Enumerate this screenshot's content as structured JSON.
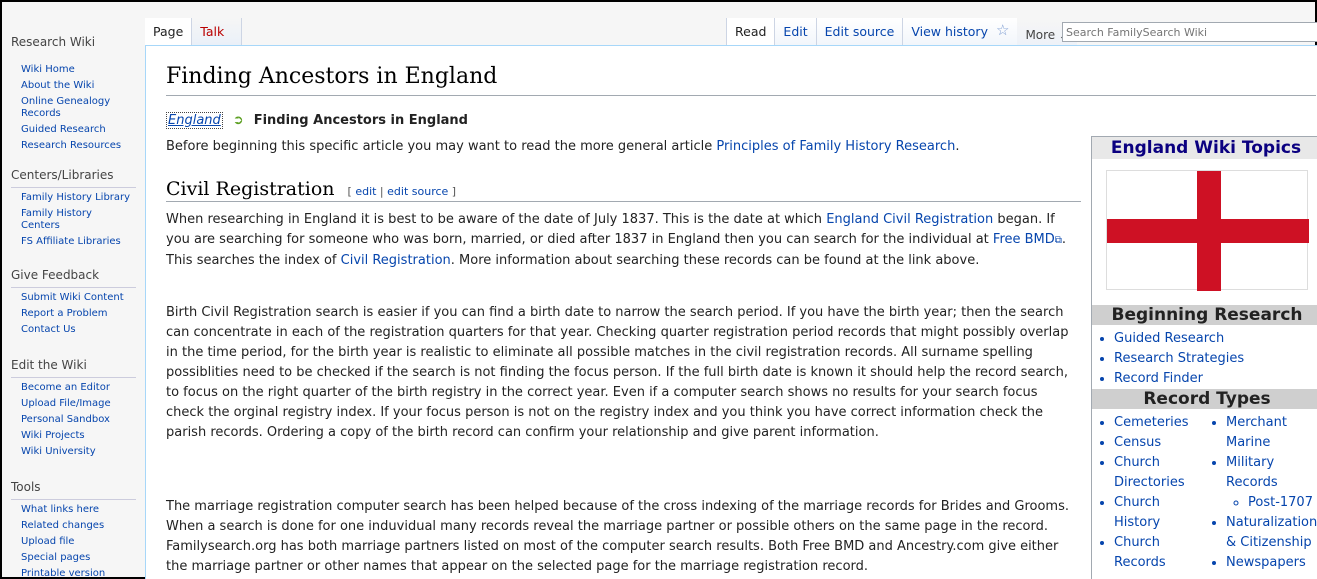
{
  "sidebar": {
    "site_name": "Research Wiki",
    "portals": [
      {
        "heading": "",
        "items": [
          "Wiki Home",
          "About the Wiki",
          "Online Genealogy Records",
          "Guided Research",
          "Research Resources"
        ]
      },
      {
        "heading": "Centers/Libraries",
        "items": [
          "Family History Library",
          "Family History Centers",
          "FS Affiliate Libraries"
        ]
      },
      {
        "heading": "Give Feedback",
        "items": [
          "Submit Wiki Content",
          "Report a Problem",
          "Contact Us"
        ]
      },
      {
        "heading": "Edit the Wiki",
        "items": [
          "Become an Editor",
          "Upload File/Image",
          "Personal Sandbox",
          "Wiki Projects",
          "Wiki University"
        ]
      },
      {
        "heading": "Tools",
        "items": [
          "What links here",
          "Related changes",
          "Upload file",
          "Special pages",
          "Printable version"
        ]
      }
    ]
  },
  "tabs": {
    "page": "Page",
    "talk": "Talk",
    "read": "Read",
    "edit": "Edit",
    "edit_source": "Edit source",
    "view_history": "View history",
    "more": "More"
  },
  "search": {
    "placeholder": "Search FamilySearch Wiki"
  },
  "article": {
    "title": "Finding Ancestors in England",
    "breadcrumb_link": "England",
    "breadcrumb_current": "Finding Ancestors in England",
    "intro_prefix": "Before beginning this specific article you may want to read the more general article ",
    "intro_link": "Principles of Family History Research",
    "intro_suffix": ".",
    "section_title": "Civil Registration",
    "edit_open": "[ ",
    "edit_link": "edit",
    "edit_sep": " | ",
    "edit_source_link": "edit source",
    "edit_close": " ]",
    "p1": {
      "a": "When researching in England it is best to be aware of the date of July 1837. This is the date at which ",
      "link1": "England Civil Registration",
      "b": " began. If you are searching for someone who was born, married, or died after 1837 in England then you can search for the individual at ",
      "link2": "Free BMD",
      "c": ". This searches the index of ",
      "link3": "Civil Registration",
      "d": ". More information about searching these records can be found at the link above."
    },
    "p2": "Birth Civil Registration search is easier if you can find a birth date to narrow the search period.  If you have the birth year; then the search can concentrate in each of the registration quarters for that year. Checking quarter registration period records that might possibly overlap in the time period, for the birth year is realistic to eliminate all possible matches in the civil registration records.  All surname spelling possiblities need to be checked if the search is not finding the focus person.  If the full birth date is known it should help the record search, to focus on the right quarter of the birth registry in the correct year. Even if a computer search shows no results for your search focus check the orginal registry index.  If your focus person is not on the registry index and you think you have correct information check the parish records.  Ordering a copy of the birth record can confirm your relationship and give parent information.",
    "p3": "The marriage registration computer search has been helped because of the cross indexing of the marriage records for Brides and Grooms.  When a search is done for one induvidual many records reveal the marriage partner or possible others on the same page in the record.  Familysearch.org has both marriage partners listed on most of the computer search results.  Both Free BMD and Ancestry.com give either the marriage partner or other names that appear on the selected page for the marriage registration record."
  },
  "infobox": {
    "title": "England Wiki Topics",
    "beginning_heading": "Beginning Research",
    "beginning_items": [
      "Guided Research",
      "Research Strategies",
      "Record Finder"
    ],
    "record_types_heading": "Record Types",
    "record_types_col1": [
      "Cemeteries",
      "Census",
      "Church Directories",
      "Church History",
      "Church Records"
    ],
    "record_types_col2": [
      "Merchant Marine",
      "Military Records",
      "Post-1707",
      "Naturalization & Citizenship",
      "Newspapers"
    ]
  }
}
